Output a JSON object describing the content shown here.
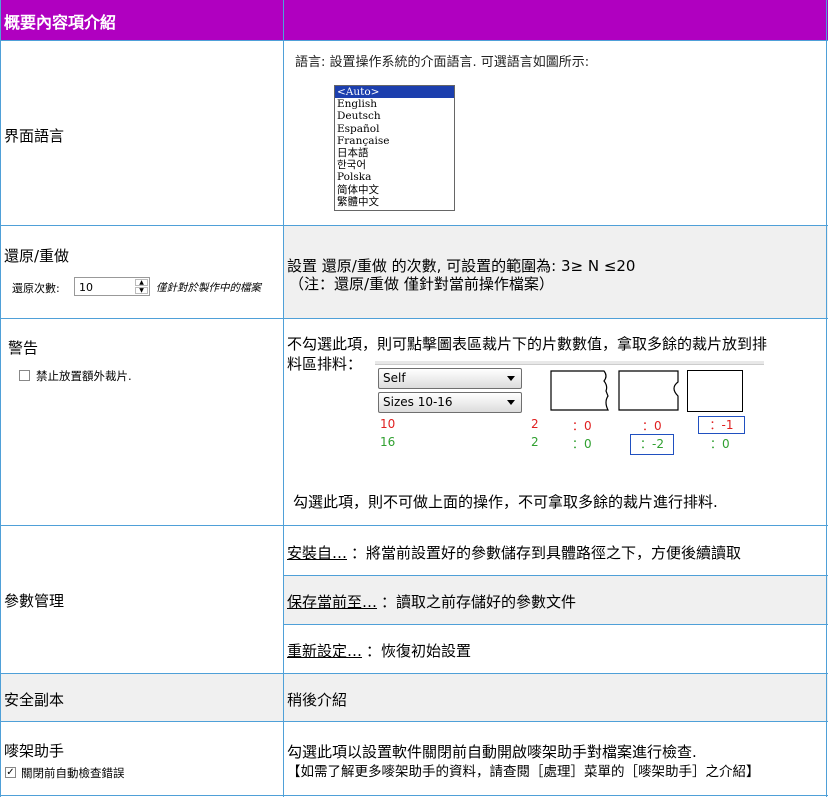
{
  "header": {
    "left": "概要內容項介紹",
    "right": ""
  },
  "rows": {
    "ui_language": {
      "label": "界面語言",
      "desc": "語言: 設置操作系統的介面語言. 可選語言如圖所示:",
      "languages": [
        "<Auto>",
        "English",
        "Deutsch",
        "Español",
        "Française",
        "日本語",
        "한국어",
        "Polska",
        "简体中文",
        "繁體中文"
      ],
      "selected_index": 0
    },
    "undo_redo": {
      "label": "還原/重做",
      "field_label": "還原次數:",
      "field_value": "10",
      "field_note": "僅針對於製作中的檔案",
      "desc_line1": "設置 還原/重做 的次數, 可設置的範圍為: 3≥ N ≤20",
      "desc_line2": "（注：還原/重做 僅針對當前操作檔案）"
    },
    "warning": {
      "label": "警告",
      "checkbox_label": "禁止放置額外裁片.",
      "desc_line1": "不勾選此項，則可點擊圖表區裁片下的片數數值，拿取多餘的裁片放到排",
      "desc_line2": "料區排料：",
      "select1": "Self",
      "select2": "Sizes 10-16",
      "size_a": "10",
      "size_b": "16",
      "col1_a": "2",
      "col1_b": "2",
      "col2_a": "：0",
      "col2_b": "：0",
      "col3_a": "：0",
      "col3_b": "：-2",
      "col4_a": "：-1",
      "col4_b": "：0",
      "desc_bottom": "勾選此項，則不可做上面的操作，不可拿取多餘的裁片進行排料."
    },
    "params": {
      "label": "參數管理",
      "item1_link": "安裝自…",
      "item1_text": "：將當前設置好的參數儲存到具體路徑之下，方便後續讀取",
      "item2_link": "保存當前至…",
      "item2_text": "：讀取之前存儲好的參數文件",
      "item3_link": "重新設定…",
      "item3_text": "：恢復初始設置"
    },
    "backup": {
      "label": "安全副本",
      "desc": "稍後介紹"
    },
    "helper": {
      "label": "嘜架助手",
      "checkbox_label": "關閉前自動檢查錯誤",
      "desc_line1": "勾選此項以設置軟件關閉前自動開啟嘜架助手對檔案進行檢查.",
      "desc_line2": "【如需了解更多嘜架助手的資料，請查閱［處理］菜單的［嘜架助手］之介紹】"
    }
  },
  "colors": {
    "header": "#b000c0",
    "grid": "#4fa0d8",
    "red": "#e02020",
    "green": "#30a030",
    "selection": "#1c3fae"
  }
}
